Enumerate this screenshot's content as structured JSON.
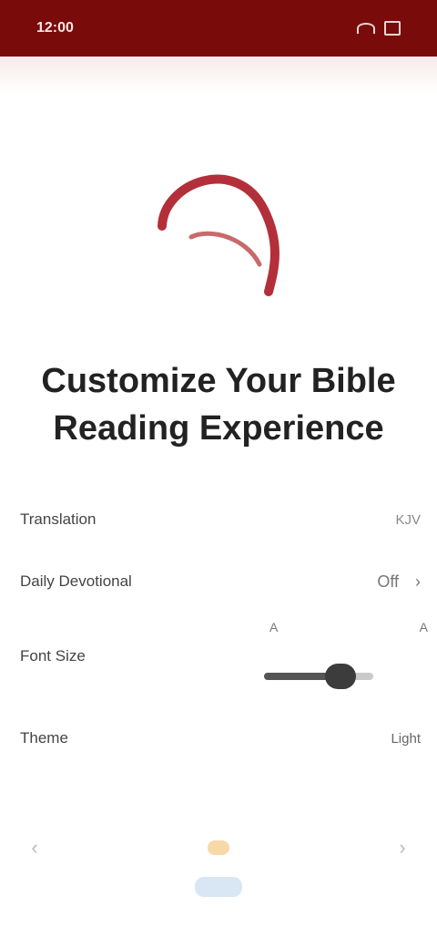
{
  "status_bar": {
    "time": "12:00"
  },
  "headline": "Customize Your Bible Reading Experience",
  "settings": {
    "translation": {
      "label": "Translation",
      "value": "KJV"
    },
    "reading_plan": {
      "label": "Daily Devotional",
      "value": "Off"
    },
    "font_size": {
      "label": "Font Size",
      "min_label": "A",
      "max_label": "A",
      "level": 0.7
    },
    "theme": {
      "label": "Theme",
      "value": "Light"
    }
  },
  "nav": {
    "prev": "‹",
    "next": "›"
  },
  "colors": {
    "status_bar": "#7a0b0b",
    "accent": "#b3303a",
    "nav_active": "#f6d9a6"
  }
}
